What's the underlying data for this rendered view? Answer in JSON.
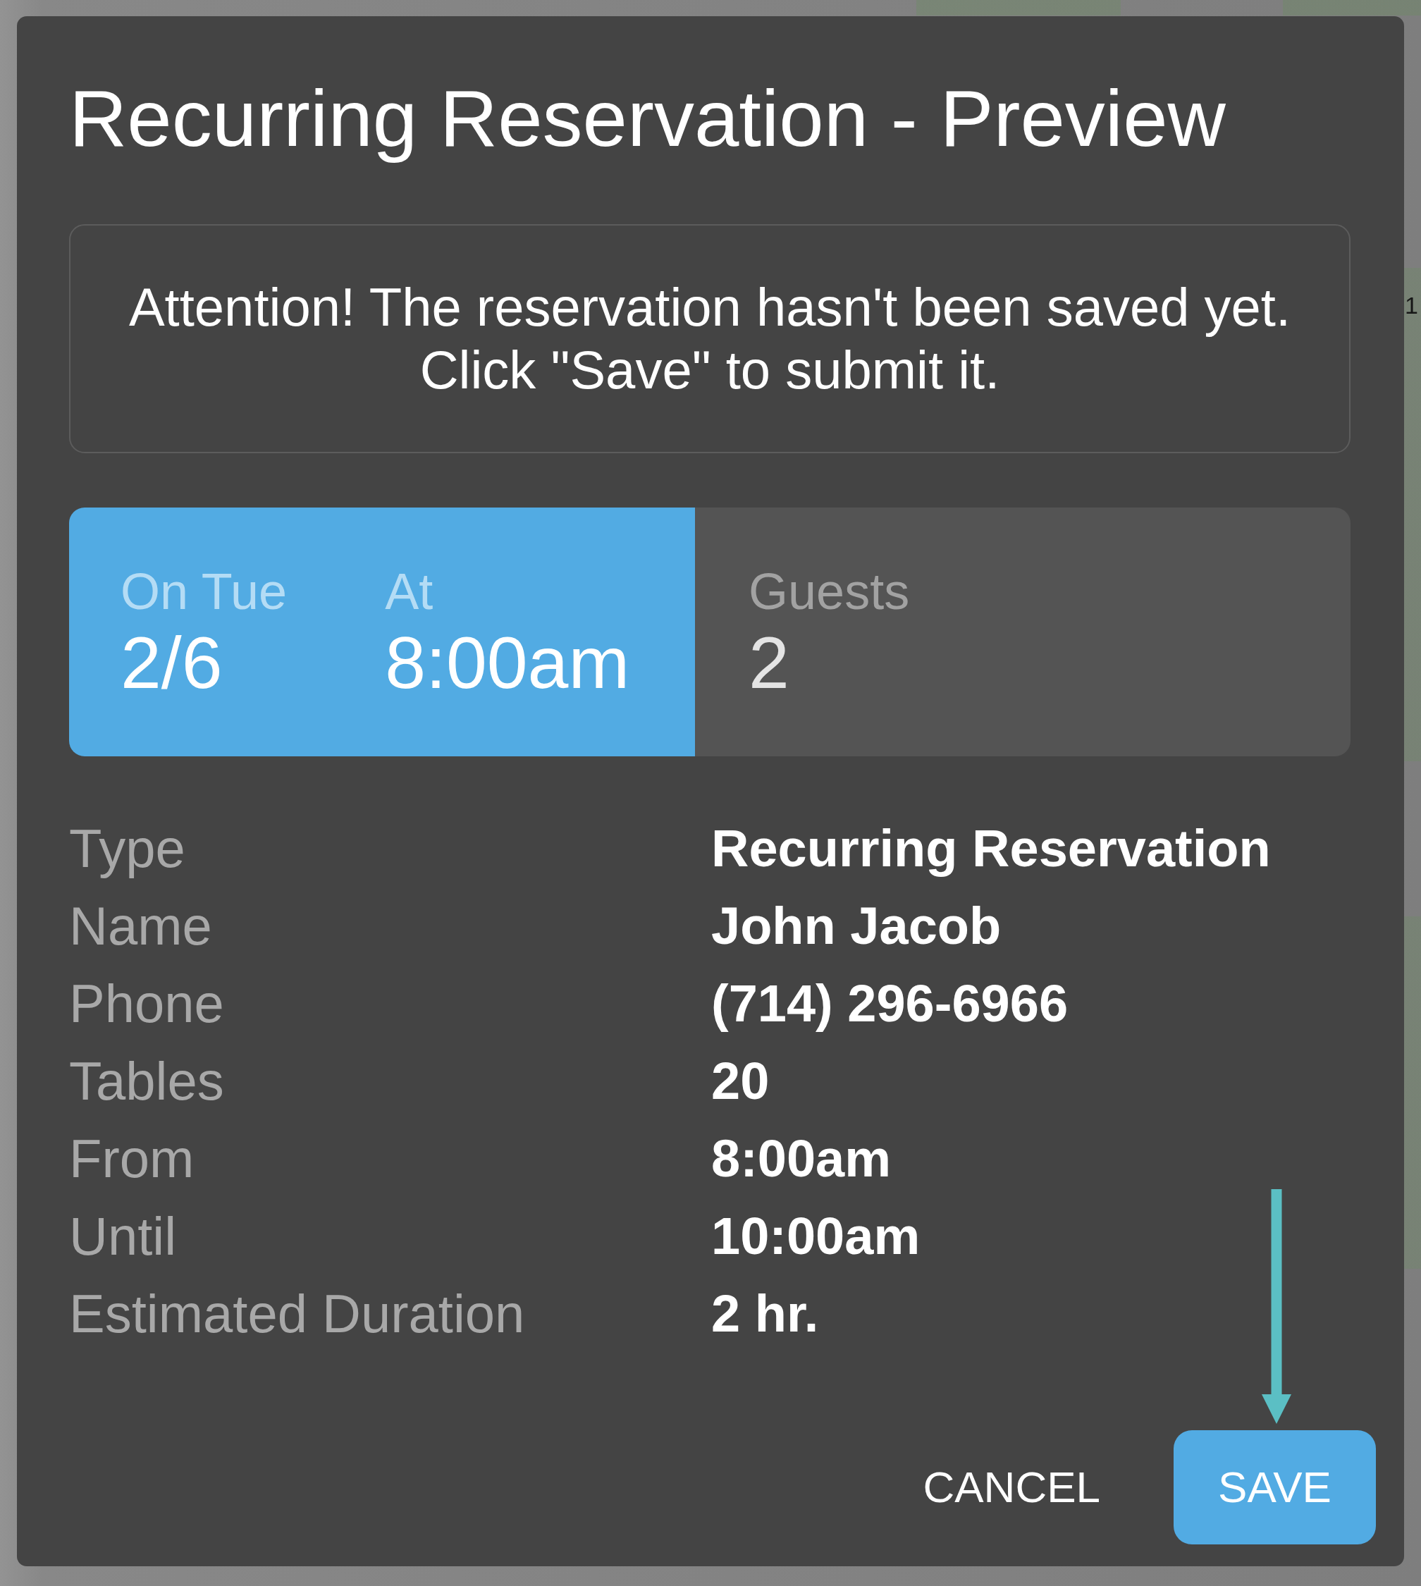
{
  "backdrop": {
    "text": "1"
  },
  "dialog": {
    "title": "Recurring Reservation - Preview",
    "notice": "Attention! The reservation hasn't been saved yet.\nClick \"Save\" to submit it.",
    "summary": [
      {
        "label": "On Tue",
        "value": "2/6",
        "highlighted": true
      },
      {
        "label": "At",
        "value": "8:00am",
        "highlighted": true
      },
      {
        "label": "Guests",
        "value": "2",
        "highlighted": false
      }
    ],
    "details": [
      {
        "label": "Type",
        "value": "Recurring Reservation"
      },
      {
        "label": "Name",
        "value": "John Jacob"
      },
      {
        "label": "Phone",
        "value": "(714) 296-6966"
      },
      {
        "label": "Tables",
        "value": "20"
      },
      {
        "label": "From",
        "value": "8:00am"
      },
      {
        "label": "Until",
        "value": "10:00am"
      },
      {
        "label": "Estimated Duration",
        "value": "2 hr."
      }
    ],
    "buttons": [
      {
        "label": "CANCEL",
        "kind": "cancel"
      },
      {
        "label": "SAVE",
        "kind": "save"
      }
    ]
  }
}
